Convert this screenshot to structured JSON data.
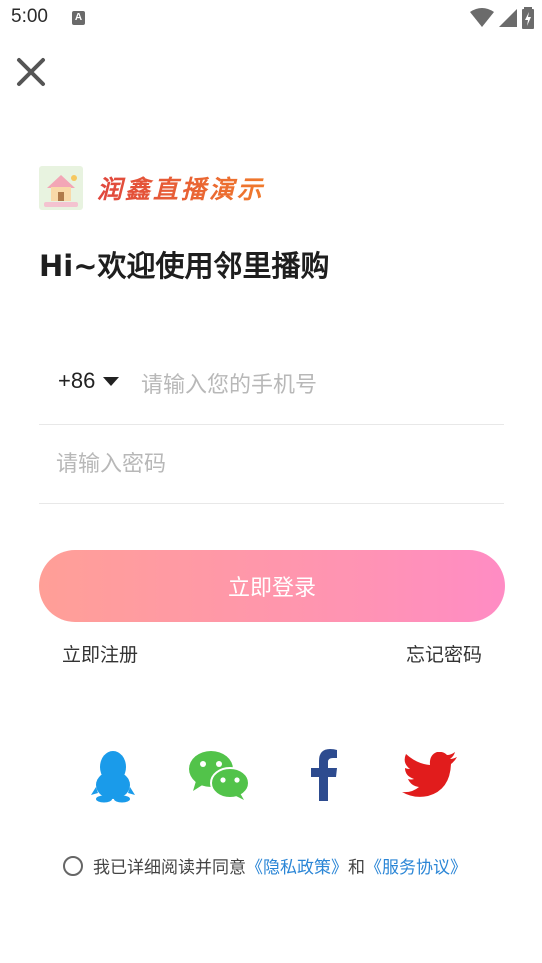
{
  "status_bar": {
    "time": "5:00",
    "notification_letter": "A"
  },
  "brand": {
    "name": "润鑫直播演示"
  },
  "welcome": {
    "title": "Hi~欢迎使用邻里播购"
  },
  "login_form": {
    "country_code": "+86",
    "phone_placeholder": "请输入您的手机号",
    "password_placeholder": "请输入密码",
    "login_label": "立即登录",
    "register_label": "立即注册",
    "forgot_label": "忘记密码"
  },
  "social": [
    {
      "name": "qq-icon",
      "color": "#1a9bea"
    },
    {
      "name": "wechat-icon",
      "color": "#52c34a"
    },
    {
      "name": "facebook-icon",
      "color": "#2d4b8f"
    },
    {
      "name": "twitter-icon",
      "color": "#e11c1c"
    }
  ],
  "agreement": {
    "prefix": "我已详细阅读并同意",
    "privacy_link": "《隐私政策》",
    "and": "和",
    "service_link": "《服务协议》"
  },
  "colors": {
    "login_gradient_start": "#ff9f97",
    "login_gradient_end": "#ff8cc4",
    "link_blue": "#2b86d6"
  }
}
